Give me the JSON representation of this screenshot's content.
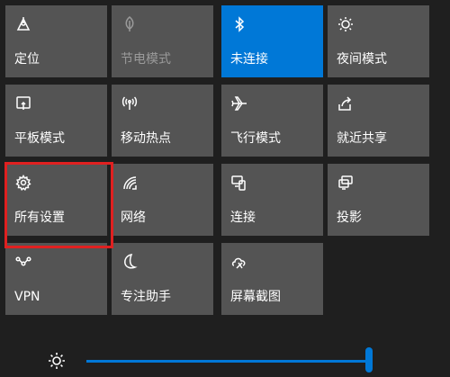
{
  "tiles": [
    {
      "label": "定位",
      "icon": "location-icon",
      "state": "normal"
    },
    {
      "label": "节电模式",
      "icon": "battery-saver-icon",
      "state": "disabled"
    },
    {
      "label": "未连接",
      "icon": "bluetooth-icon",
      "state": "active"
    },
    {
      "label": "夜间模式",
      "icon": "night-light-icon",
      "state": "normal"
    },
    {
      "label": "平板模式",
      "icon": "tablet-mode-icon",
      "state": "normal"
    },
    {
      "label": "移动热点",
      "icon": "mobile-hotspot-icon",
      "state": "normal"
    },
    {
      "label": "飞行模式",
      "icon": "airplane-icon",
      "state": "normal"
    },
    {
      "label": "就近共享",
      "icon": "nearby-share-icon",
      "state": "normal"
    },
    {
      "label": "所有设置",
      "icon": "gear-icon",
      "state": "normal"
    },
    {
      "label": "网络",
      "icon": "network-icon",
      "state": "normal"
    },
    {
      "label": "连接",
      "icon": "connect-icon",
      "state": "normal"
    },
    {
      "label": "投影",
      "icon": "project-icon",
      "state": "normal"
    },
    {
      "label": "VPN",
      "icon": "vpn-icon",
      "state": "normal"
    },
    {
      "label": "专注助手",
      "icon": "focus-assist-icon",
      "state": "normal"
    },
    {
      "label": "屏幕截图",
      "icon": "screenshot-icon",
      "state": "normal"
    }
  ],
  "brightness": {
    "icon": "brightness-icon",
    "level": 1.0
  },
  "colors": {
    "background": "#1f1f1f",
    "tile": "#545454",
    "accent": "#0078d7",
    "highlight": "#e02020"
  }
}
